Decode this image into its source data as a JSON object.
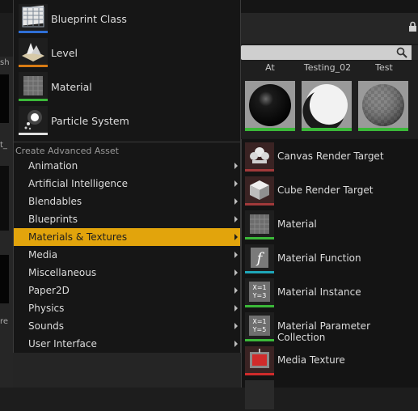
{
  "colors": {
    "accent": "#e2a40c",
    "blueprint_underline": "#2f6fd6",
    "level_underline": "#d87b14",
    "material_underline": "#3bb839",
    "particle_underline": "#e0e0e0",
    "render_target_underline": "#a1393a",
    "function_underline": "#1fa6b8",
    "media_underline": "#d12b2b"
  },
  "background": {
    "thumbnail_labels": [
      "At",
      "Testing_02",
      "Test"
    ],
    "left_fragments": [
      "sh",
      "t_",
      "re"
    ]
  },
  "menu": {
    "primary_assets": [
      {
        "label": "Blueprint Class",
        "icon": "blueprint-class-icon"
      },
      {
        "label": "Level",
        "icon": "level-icon"
      },
      {
        "label": "Material",
        "icon": "material-icon"
      },
      {
        "label": "Particle System",
        "icon": "particle-system-icon"
      }
    ],
    "section_header": "Create Advanced Asset",
    "categories": [
      {
        "label": "Animation"
      },
      {
        "label": "Artificial Intelligence"
      },
      {
        "label": "Blendables"
      },
      {
        "label": "Blueprints"
      },
      {
        "label": "Materials & Textures",
        "active": true
      },
      {
        "label": "Media"
      },
      {
        "label": "Miscellaneous"
      },
      {
        "label": "Paper2D"
      },
      {
        "label": "Physics"
      },
      {
        "label": "Sounds"
      },
      {
        "label": "User Interface"
      }
    ]
  },
  "submenu": {
    "items": [
      {
        "label": "Canvas Render Target",
        "icon": "canvas-render-target-icon"
      },
      {
        "label": "Cube Render Target",
        "icon": "cube-render-target-icon"
      },
      {
        "label": "Material",
        "icon": "material-icon"
      },
      {
        "label": "Material Function",
        "icon": "material-function-icon"
      },
      {
        "label": "Material Instance",
        "icon": "material-instance-icon"
      },
      {
        "label": "Material Parameter Collection",
        "icon": "material-parameter-collection-icon"
      },
      {
        "label": "Media Texture",
        "icon": "media-texture-icon"
      }
    ],
    "icon_text": {
      "material_instance": [
        "X=1",
        "Y=3"
      ],
      "parameter_collection": [
        "X=1",
        "Y=5"
      ]
    }
  }
}
